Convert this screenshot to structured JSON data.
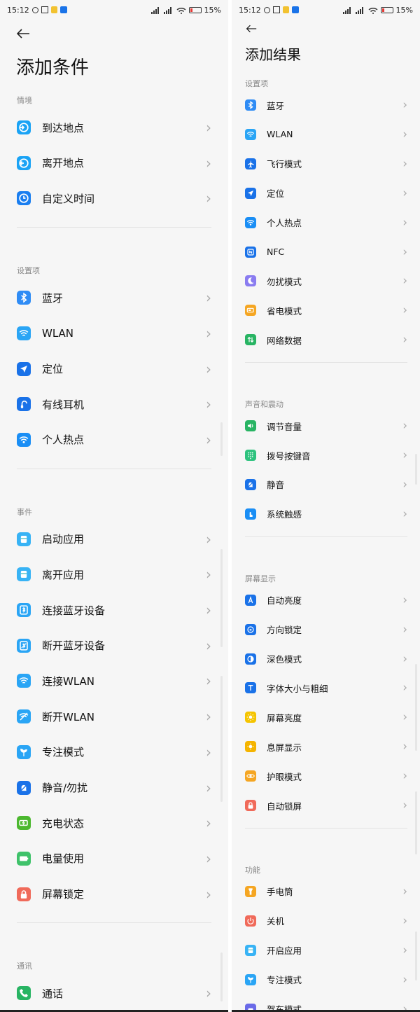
{
  "left": {
    "status": {
      "time": "15:12",
      "battery": "15%"
    },
    "title": "添加条件",
    "sections": [
      {
        "label": "情境",
        "items": [
          {
            "label": "到达地点",
            "icon": "arrive-location-icon",
            "color": "#1aa3f5"
          },
          {
            "label": "离开地点",
            "icon": "leave-location-icon",
            "color": "#1aa3f5"
          },
          {
            "label": "自定义时间",
            "icon": "clock-icon",
            "color": "#1a7ef0"
          }
        ]
      },
      {
        "label": "设置项",
        "items": [
          {
            "label": "蓝牙",
            "icon": "bluetooth-icon",
            "color": "#2f8cf5"
          },
          {
            "label": "WLAN",
            "icon": "wifi-icon",
            "color": "#2aa5f5"
          },
          {
            "label": "定位",
            "icon": "location-arrow-icon",
            "color": "#1a72e8"
          },
          {
            "label": "有线耳机",
            "icon": "headphone-icon",
            "color": "#1a72e8"
          },
          {
            "label": "个人热点",
            "icon": "hotspot-icon",
            "color": "#1a8ef5"
          }
        ]
      },
      {
        "label": "事件",
        "items": [
          {
            "label": "启动应用",
            "icon": "app-launch-icon",
            "color": "#38b3f5"
          },
          {
            "label": "离开应用",
            "icon": "app-leave-icon",
            "color": "#38b3f5"
          },
          {
            "label": "连接蓝牙设备",
            "icon": "bluetooth-connect-icon",
            "color": "#2aa5f5"
          },
          {
            "label": "断开蓝牙设备",
            "icon": "bluetooth-disconnect-icon",
            "color": "#2aa5f5"
          },
          {
            "label": "连接WLAN",
            "icon": "wifi-connect-icon",
            "color": "#2aa5f5"
          },
          {
            "label": "断开WLAN",
            "icon": "wifi-disconnect-icon",
            "color": "#2aa5f5"
          },
          {
            "label": "专注模式",
            "icon": "focus-sprout-icon",
            "color": "#2aa5f5"
          },
          {
            "label": "静音/勿扰",
            "icon": "mute-bell-icon",
            "color": "#1a72e8"
          },
          {
            "label": "充电状态",
            "icon": "charging-icon",
            "color": "#4cb82f"
          },
          {
            "label": "电量使用",
            "icon": "battery-usage-icon",
            "color": "#3fc26a"
          },
          {
            "label": "屏幕锁定",
            "icon": "lock-icon",
            "color": "#f06a5a"
          }
        ]
      },
      {
        "label": "通讯",
        "items": [
          {
            "label": "通话",
            "icon": "phone-icon",
            "color": "#28b463"
          }
        ]
      }
    ]
  },
  "right": {
    "status": {
      "time": "15:12",
      "battery": "15%"
    },
    "title": "添加结果",
    "sections": [
      {
        "label": "设置项",
        "items": [
          {
            "label": "蓝牙",
            "icon": "bluetooth-icon",
            "color": "#2f8cf5"
          },
          {
            "label": "WLAN",
            "icon": "wifi-icon",
            "color": "#2aa5f5"
          },
          {
            "label": "飞行模式",
            "icon": "airplane-icon",
            "color": "#1a72e8"
          },
          {
            "label": "定位",
            "icon": "location-arrow-icon",
            "color": "#1a72e8"
          },
          {
            "label": "个人热点",
            "icon": "hotspot-icon",
            "color": "#1a8ef5"
          },
          {
            "label": "NFC",
            "icon": "nfc-icon",
            "color": "#1a72e8"
          },
          {
            "label": "勿扰模式",
            "icon": "moon-icon",
            "color": "#8a7cf0"
          },
          {
            "label": "省电模式",
            "icon": "battery-saver-icon",
            "color": "#f5a623"
          },
          {
            "label": "网络数据",
            "icon": "mobile-data-icon",
            "color": "#28b463"
          }
        ]
      },
      {
        "label": "声音和震动",
        "items": [
          {
            "label": "调节音量",
            "icon": "volume-icon",
            "color": "#28b463"
          },
          {
            "label": "拨号按键音",
            "icon": "dialpad-icon",
            "color": "#2ec27e"
          },
          {
            "label": "静音",
            "icon": "mute-bell-icon",
            "color": "#1a72e8"
          },
          {
            "label": "系统触感",
            "icon": "touch-icon",
            "color": "#1a8ef5"
          }
        ]
      },
      {
        "label": "屏幕显示",
        "items": [
          {
            "label": "自动亮度",
            "icon": "auto-brightness-icon",
            "color": "#1a72e8"
          },
          {
            "label": "方向锁定",
            "icon": "rotation-lock-icon",
            "color": "#1a72e8"
          },
          {
            "label": "深色模式",
            "icon": "dark-mode-icon",
            "color": "#1a72e8"
          },
          {
            "label": "字体大小与粗细",
            "icon": "font-size-icon",
            "color": "#1a72e8"
          },
          {
            "label": "屏幕亮度",
            "icon": "sun-icon",
            "color": "#f5c400"
          },
          {
            "label": "息屏显示",
            "icon": "aod-icon",
            "color": "#f5b400"
          },
          {
            "label": "护眼模式",
            "icon": "eye-icon",
            "color": "#f5a623"
          },
          {
            "label": "自动锁屏",
            "icon": "lock-icon",
            "color": "#f06a5a"
          }
        ]
      },
      {
        "label": "功能",
        "items": [
          {
            "label": "手电筒",
            "icon": "flashlight-icon",
            "color": "#f5a623"
          },
          {
            "label": "关机",
            "icon": "power-icon",
            "color": "#f06a5a"
          },
          {
            "label": "开启应用",
            "icon": "app-launch-icon",
            "color": "#38b3f5"
          },
          {
            "label": "专注模式",
            "icon": "focus-sprout-icon",
            "color": "#2aa5f5"
          },
          {
            "label": "驾车模式",
            "icon": "car-icon",
            "color": "#6a6ae8"
          }
        ]
      }
    ]
  }
}
